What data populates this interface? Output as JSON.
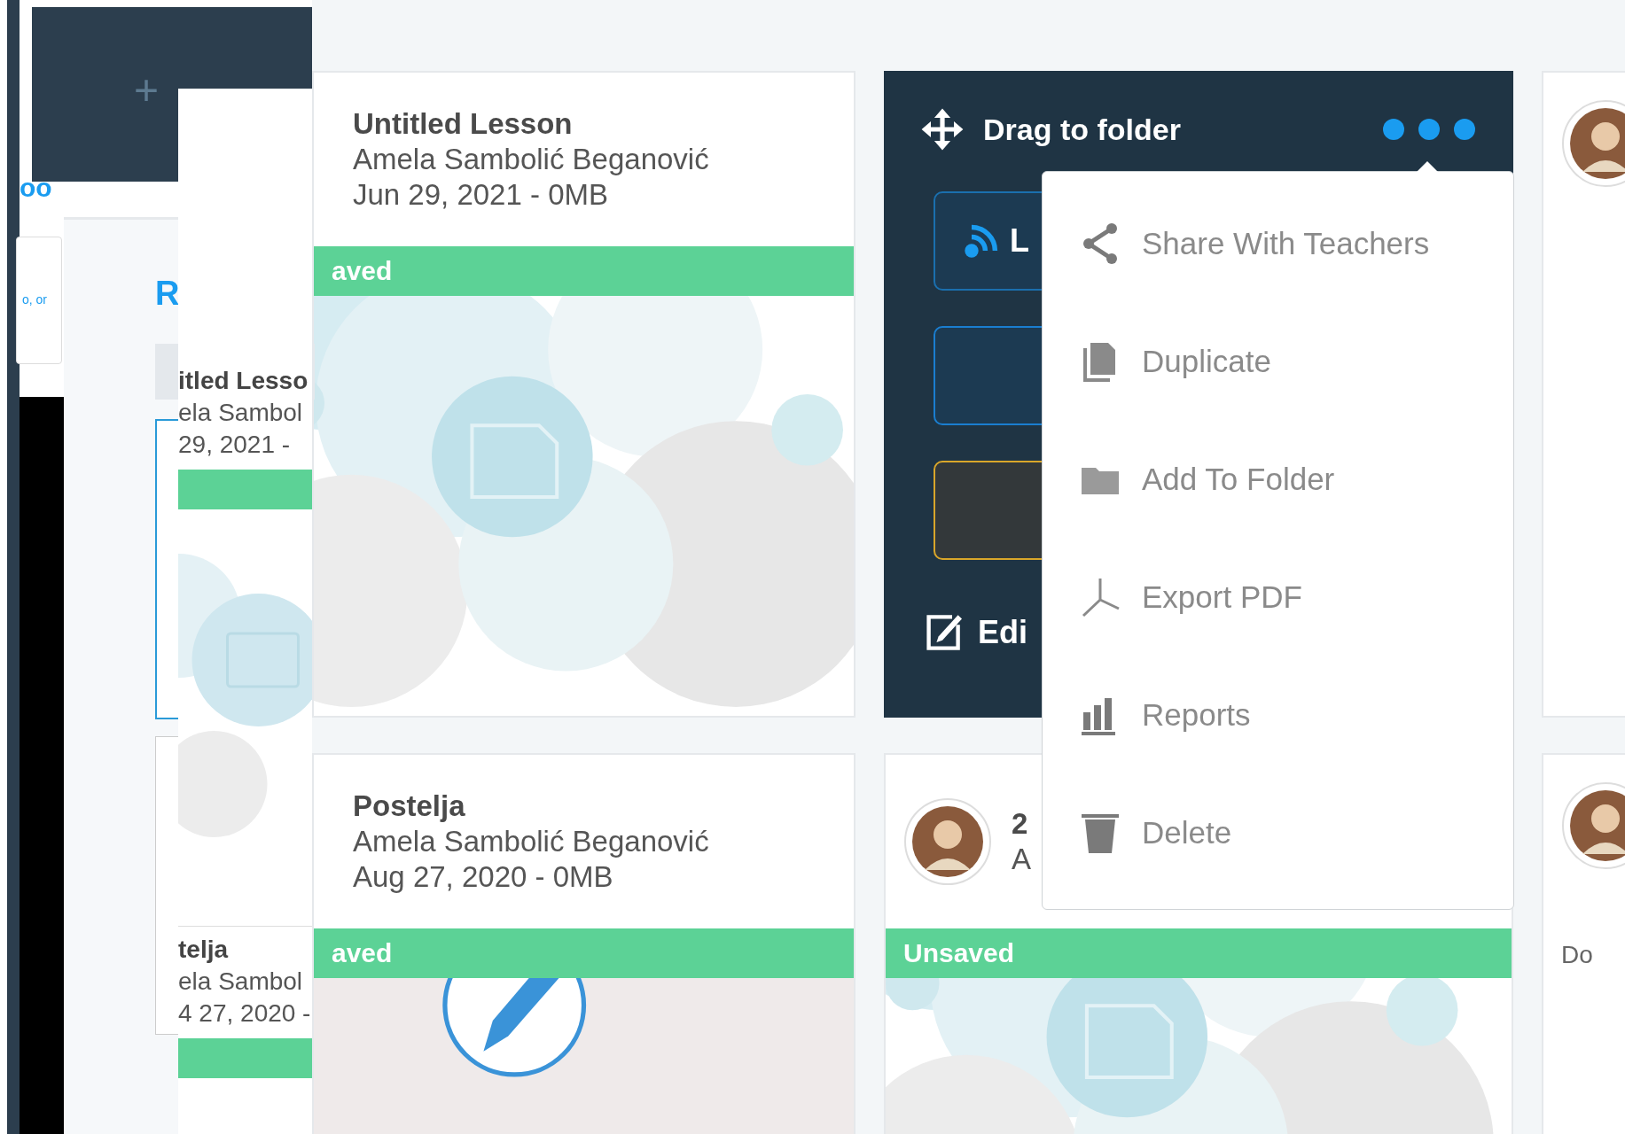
{
  "left_panel": {
    "add_label": "+",
    "link_text": "oo",
    "hint": "o, or",
    "heading": "R",
    "lesson_cards": [
      {
        "title": "itled Lesso",
        "author": "ela Sambol",
        "date": "29, 2021 -",
        "status_bar": true
      },
      {
        "title": "telja",
        "author": "ela Sambol",
        "date": "4 27, 2020 -",
        "status_bar": true
      }
    ]
  },
  "lessons": [
    {
      "kind": "card",
      "title": "Untitled Lesson",
      "author": "Amela Sambolić Beganović",
      "date": "Jun 29, 2021 - 0MB",
      "status": "aved",
      "thumbnail": {
        "kind": "bubbles"
      },
      "avatar": false
    },
    {
      "kind": "hover",
      "drag_label": "Drag to folder",
      "buttons": [
        {
          "kind": "live",
          "label": "L"
        },
        {
          "kind": "blue"
        },
        {
          "kind": "yellow"
        }
      ],
      "edit_label": "Edi"
    },
    {
      "kind": "avatar_only"
    },
    {
      "kind": "card",
      "title": "Postelja",
      "author": "Amela Sambolić Beganović",
      "date": "Aug 27, 2020 - 0MB",
      "status": "aved",
      "thumbnail": {
        "kind": "pencil"
      },
      "avatar": false
    },
    {
      "kind": "card",
      "title": "2",
      "author": "A",
      "status": "Unsaved",
      "thumbnail": {
        "kind": "bubbles"
      },
      "avatar": true
    },
    {
      "kind": "stub",
      "text": "Do"
    }
  ],
  "menu": {
    "items": [
      {
        "label": "Share With Teachers"
      },
      {
        "label": "Duplicate"
      },
      {
        "label": "Add To Folder"
      },
      {
        "label": "Export PDF"
      },
      {
        "label": "Reports"
      },
      {
        "label": "Delete"
      }
    ]
  }
}
